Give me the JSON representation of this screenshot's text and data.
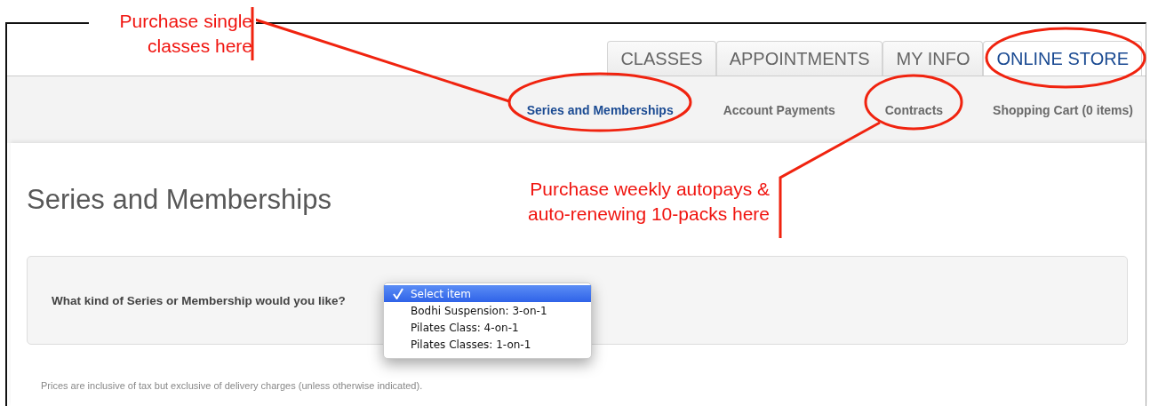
{
  "tabs": [
    {
      "label": "CLASSES",
      "selected": false
    },
    {
      "label": "APPOINTMENTS",
      "selected": false
    },
    {
      "label": "MY INFO",
      "selected": false
    },
    {
      "label": "ONLINE STORE",
      "selected": true
    }
  ],
  "subnav": [
    {
      "label": "Series and Memberships",
      "selected": true
    },
    {
      "label": "Account Payments",
      "selected": false
    },
    {
      "label": "Contracts",
      "selected": false
    },
    {
      "label": "Shopping Cart (0 items)",
      "selected": false
    }
  ],
  "heading": "Series and Memberships",
  "question": {
    "label": "What kind of Series or Membership would you like?",
    "options": [
      {
        "label": "Select item",
        "selected": true
      },
      {
        "label": "Bodhi Suspension: 3-on-1",
        "selected": false
      },
      {
        "label": "Pilates Class: 4-on-1",
        "selected": false
      },
      {
        "label": "Pilates Classes: 1-on-1",
        "selected": false
      }
    ]
  },
  "note": "Prices are inclusive of tax but exclusive of delivery charges (unless otherwise indicated).",
  "annotations": [
    {
      "text": "Purchase single classes here"
    },
    {
      "text": "Purchase weekly autopays & auto-renewing 10-packs here"
    }
  ]
}
